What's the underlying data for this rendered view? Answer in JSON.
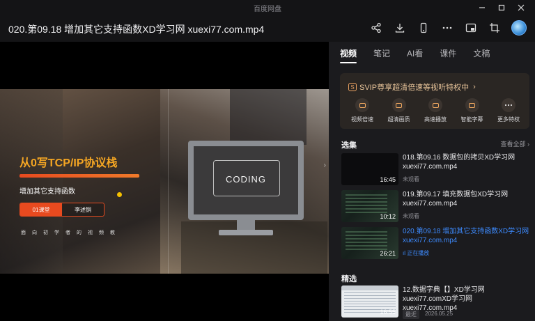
{
  "app": {
    "name": "百度网盘"
  },
  "file": {
    "title": "020.第09.18 增加其它支持函数XD学习网 xuexi77.com.mp4"
  },
  "toolbar": {
    "icons": [
      "share-icon",
      "download-icon",
      "phone-icon",
      "more-icon",
      "picture-in-picture-icon",
      "crop-icon",
      "avatar"
    ]
  },
  "video": {
    "course_title": "从0写TCP/IP协议栈",
    "subtitle": "增加其它支持函数",
    "tag_a": "01课堂",
    "tag_b": "李述铜",
    "desc": "面向初学者的视频教",
    "screen_text": "CODING"
  },
  "panel": {
    "tabs": [
      "视频",
      "笔记",
      "AI看",
      "课件",
      "文稿"
    ],
    "active_tab": 0,
    "svip": {
      "headline": "SVIP尊享超清倍速等视听特权中",
      "perks": [
        "视频倍速",
        "超清画质",
        "高速播放",
        "智能字幕",
        "更多特权"
      ]
    },
    "selection": {
      "title": "选集",
      "view_all": "查看全部",
      "episodes": [
        {
          "title": "018.第09.16 数据包的拷贝XD学习网 xuexi77.com.mp4",
          "duration": "16:45",
          "status": "未观看",
          "current": false
        },
        {
          "title": "019.第09.17 填充数据包XD学习网 xuexi77.com.mp4",
          "duration": "10:12",
          "status": "未观看",
          "current": false
        },
        {
          "title": "020.第09.18 增加其它支持函数XD学习网 xuexi77.com.mp4",
          "duration": "26:21",
          "status": "正在播放",
          "current": true
        }
      ]
    },
    "picks": {
      "title": "精选",
      "item_title": "12.数据字典【】XD学习网 xuexi77.comXD学习网 xuexi77.com.mp4",
      "duration": "16:55",
      "badge": "最近",
      "date": "2026.05.25"
    }
  }
}
